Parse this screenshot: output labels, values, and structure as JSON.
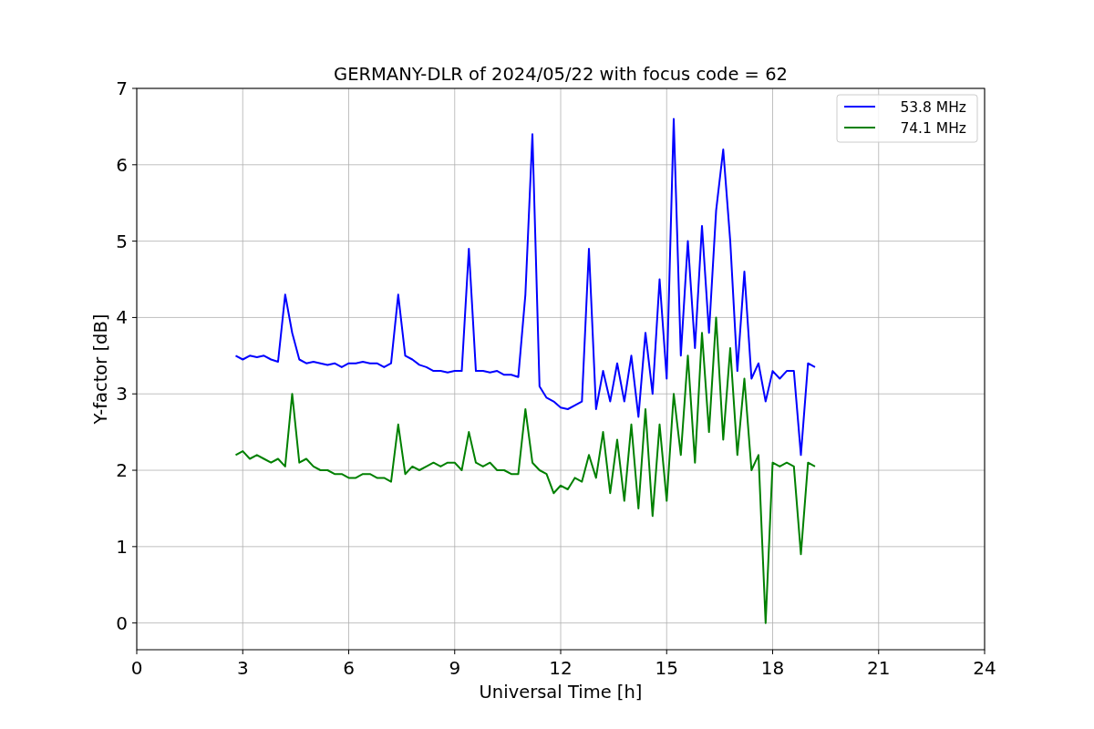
{
  "figure": {
    "chart_data": {
      "type": "line",
      "title": "GERMANY-DLR of 2024/05/22 with focus code = 62",
      "xlabel": "Universal Time [h]",
      "ylabel": "Y-factor [dB]",
      "xlim": [
        0,
        24
      ],
      "ylim": [
        -0.35,
        7
      ],
      "xticks": [
        0,
        3,
        6,
        9,
        12,
        15,
        18,
        21,
        24
      ],
      "yticks": [
        0,
        1,
        2,
        3,
        4,
        5,
        6,
        7
      ],
      "grid": true,
      "legend": "upper right",
      "x": [
        2.8,
        3.0,
        3.2,
        3.4,
        3.6,
        3.8,
        4.0,
        4.2,
        4.4,
        4.6,
        4.8,
        5.0,
        5.2,
        5.4,
        5.6,
        5.8,
        6.0,
        6.2,
        6.4,
        6.6,
        6.8,
        7.0,
        7.2,
        7.4,
        7.6,
        7.8,
        8.0,
        8.2,
        8.4,
        8.6,
        8.8,
        9.0,
        9.2,
        9.4,
        9.6,
        9.8,
        10.0,
        10.2,
        10.4,
        10.6,
        10.8,
        11.0,
        11.2,
        11.4,
        11.6,
        11.8,
        12.0,
        12.2,
        12.4,
        12.6,
        12.8,
        13.0,
        13.2,
        13.4,
        13.6,
        13.8,
        14.0,
        14.2,
        14.4,
        14.6,
        14.8,
        15.0,
        15.2,
        15.4,
        15.6,
        15.8,
        16.0,
        16.2,
        16.4,
        16.6,
        16.8,
        17.0,
        17.2,
        17.4,
        17.6,
        17.8,
        18.0,
        18.2,
        18.4,
        18.6,
        18.8,
        19.0,
        19.2
      ],
      "series": [
        {
          "name": "53.8 MHz",
          "color": "#0000ff",
          "values": [
            3.5,
            3.45,
            3.5,
            3.48,
            3.5,
            3.45,
            3.42,
            4.3,
            3.8,
            3.45,
            3.4,
            3.42,
            3.4,
            3.38,
            3.4,
            3.35,
            3.4,
            3.4,
            3.42,
            3.4,
            3.4,
            3.35,
            3.4,
            4.3,
            3.5,
            3.45,
            3.38,
            3.35,
            3.3,
            3.3,
            3.28,
            3.3,
            3.3,
            4.9,
            3.3,
            3.3,
            3.28,
            3.3,
            3.25,
            3.25,
            3.22,
            4.3,
            6.4,
            3.1,
            2.95,
            2.9,
            2.82,
            2.8,
            2.85,
            2.9,
            4.9,
            2.8,
            3.3,
            2.9,
            3.4,
            2.9,
            3.5,
            2.7,
            3.8,
            3.0,
            4.5,
            3.2,
            6.6,
            3.5,
            5.0,
            3.6,
            5.2,
            3.8,
            5.4,
            6.2,
            5.0,
            3.3,
            4.6,
            3.2,
            3.4,
            2.9,
            3.3,
            3.2,
            3.3,
            3.3,
            2.2,
            3.4,
            3.35
          ]
        },
        {
          "name": "74.1 MHz",
          "color": "#008000",
          "values": [
            2.2,
            2.25,
            2.15,
            2.2,
            2.15,
            2.1,
            2.15,
            2.05,
            3.0,
            2.1,
            2.15,
            2.05,
            2.0,
            2.0,
            1.95,
            1.95,
            1.9,
            1.9,
            1.95,
            1.95,
            1.9,
            1.9,
            1.85,
            2.6,
            1.95,
            2.05,
            2.0,
            2.05,
            2.1,
            2.05,
            2.1,
            2.1,
            2.0,
            2.5,
            2.1,
            2.05,
            2.1,
            2.0,
            2.0,
            1.95,
            1.95,
            2.8,
            2.1,
            2.0,
            1.95,
            1.7,
            1.8,
            1.75,
            1.9,
            1.85,
            2.2,
            1.9,
            2.5,
            1.7,
            2.4,
            1.6,
            2.6,
            1.5,
            2.8,
            1.4,
            2.6,
            1.6,
            3.0,
            2.2,
            3.5,
            2.1,
            3.8,
            2.5,
            4.0,
            2.4,
            3.6,
            2.2,
            3.2,
            2.0,
            2.2,
            0.0,
            2.1,
            2.05,
            2.1,
            2.05,
            0.9,
            2.1,
            2.05
          ]
        }
      ]
    }
  }
}
